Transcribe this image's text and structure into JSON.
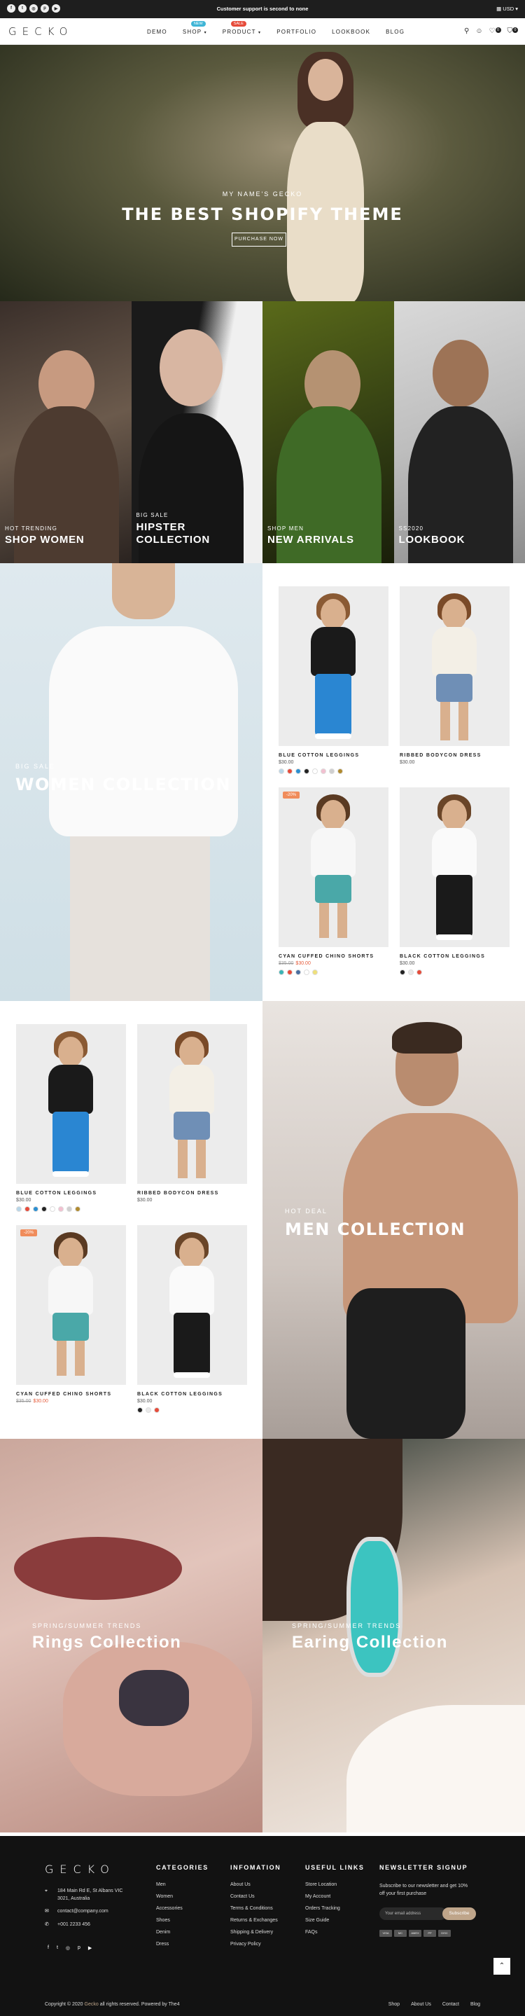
{
  "topbar": {
    "social_icons": [
      "facebook-icon",
      "twitter-icon",
      "instagram-icon",
      "pinterest-icon",
      "youtube-icon"
    ],
    "social_glyphs": [
      "f",
      "t",
      "◎",
      "p",
      "▶"
    ],
    "message": "Customer support is second to none",
    "currency": "USD"
  },
  "header": {
    "logo": "GECKO",
    "nav": [
      {
        "label": "DEMO"
      },
      {
        "label": "SHOP",
        "badge": "NEW",
        "badge_color": "#3fb5d6"
      },
      {
        "label": "PRODUCT",
        "badge": "SALE",
        "badge_color": "#e64b3a"
      },
      {
        "label": "PORTFOLIO"
      },
      {
        "label": "LOOKBOOK"
      },
      {
        "label": "BLOG"
      }
    ],
    "cart_count": "0",
    "wishlist_count": "0"
  },
  "hero": {
    "subtitle": "MY NAME'S GECKO",
    "title": "THE BEST SHOPIFY THEME",
    "button": "PURCHASE NOW"
  },
  "categories": [
    {
      "sub": "HOT TRENDING",
      "title": "SHOP WOMEN"
    },
    {
      "sub": "BIG SALE",
      "title": "HIPSTER COLLECTION"
    },
    {
      "sub": "SHOP MEN",
      "title": "NEW ARRIVALS"
    },
    {
      "sub": "SS2020",
      "title": "LOOKBOOK"
    }
  ],
  "women_section": {
    "sub": "BIG SALE",
    "title": "WOMEN COLLECTION"
  },
  "men_section": {
    "sub": "HOT DEAL",
    "title": "MEN COLLECTION"
  },
  "products": [
    {
      "name": "BLUE COTTON LEGGINGS",
      "price": "$30.00",
      "swatches": [
        "#b8d6e8",
        "#e64b3a",
        "#2b8fd1",
        "#222222",
        "#ffffff",
        "#f2c0d0",
        "#cfcfcf",
        "#b08a2e"
      ]
    },
    {
      "name": "RIBBED BODYCON DRESS",
      "price": "$30.00",
      "swatches": []
    },
    {
      "name": "CYAN CUFFED CHINO SHORTS",
      "old_price": "$35.00",
      "price": "$30.00",
      "sale_badge": "-20%",
      "swatches": [
        "#3bb4b5",
        "#e64b3a",
        "#4a6fa0",
        "#ffffff",
        "#efe07a"
      ]
    },
    {
      "name": "BLACK COTTON LEGGINGS",
      "price": "$30.00",
      "swatches": [
        "#222222",
        "#e9e9e9",
        "#e64b3a"
      ]
    }
  ],
  "jewelry": [
    {
      "sub": "SPRING/SUMMER TRENDS",
      "title": "Rings Collection"
    },
    {
      "sub": "SPRING/SUMMER TRENDS",
      "title": "Earing Collection"
    }
  ],
  "footer": {
    "logo": "GECKO",
    "address": "184 Main Rd E, St Albans VIC 3021, Australia",
    "email": "contact@company.com",
    "phone": "+001 2233 456",
    "social": [
      "f",
      "t",
      "◎",
      "p",
      "▶"
    ],
    "categories": {
      "title": "CATEGORIES",
      "links": [
        "Men",
        "Women",
        "Accessories",
        "Shoes",
        "Denim",
        "Dress"
      ]
    },
    "infomation": {
      "title": "INFOMATION",
      "links": [
        "About Us",
        "Contact Us",
        "Terms & Conditions",
        "Returns & Exchanges",
        "Shipping & Delivery",
        "Privacy Policy"
      ]
    },
    "useful": {
      "title": "USEFUL LINKS",
      "links": [
        "Store Location",
        "My Account",
        "Orders Tracking",
        "Size Guide",
        "FAQs"
      ]
    },
    "newsletter": {
      "title": "NEWSLETTER SIGNUP",
      "text": "Subscribe to our newsletter and get 10% off your first purchase",
      "placeholder": "Your email address",
      "button": "Subscribe"
    },
    "payments": [
      "VISA",
      "MC",
      "AMEX",
      "PP",
      "DISC"
    ],
    "copyright_prefix": "Copyright © 2020 ",
    "copyright_brand": "Gecko",
    "copyright_suffix": " all rights reserved. Powered by The4",
    "bottom_links": [
      "Shop",
      "About Us",
      "Contact",
      "Blog"
    ]
  }
}
